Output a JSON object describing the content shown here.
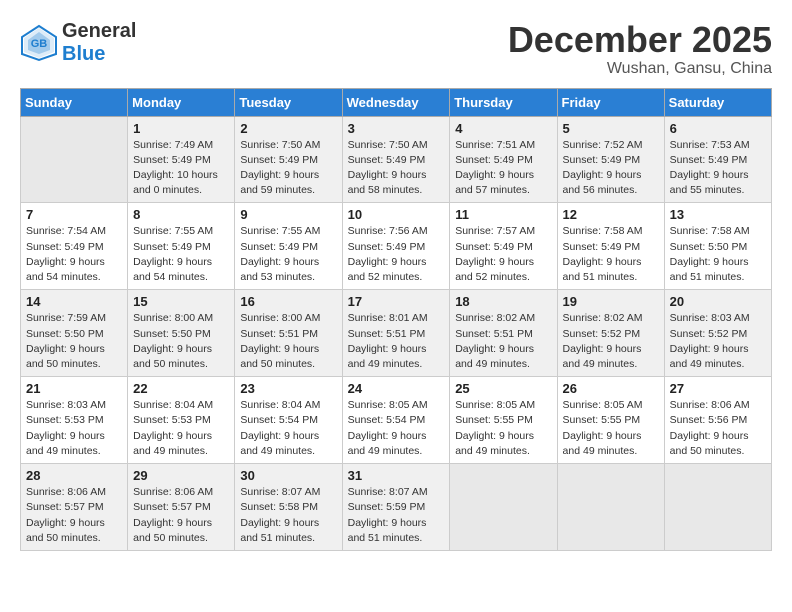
{
  "logo": {
    "general": "General",
    "blue": "Blue"
  },
  "title": "December 2025",
  "location": "Wushan, Gansu, China",
  "days_of_week": [
    "Sunday",
    "Monday",
    "Tuesday",
    "Wednesday",
    "Thursday",
    "Friday",
    "Saturday"
  ],
  "weeks": [
    [
      {
        "day": "",
        "info": ""
      },
      {
        "day": "1",
        "info": "Sunrise: 7:49 AM\nSunset: 5:49 PM\nDaylight: 10 hours\nand 0 minutes."
      },
      {
        "day": "2",
        "info": "Sunrise: 7:50 AM\nSunset: 5:49 PM\nDaylight: 9 hours\nand 59 minutes."
      },
      {
        "day": "3",
        "info": "Sunrise: 7:50 AM\nSunset: 5:49 PM\nDaylight: 9 hours\nand 58 minutes."
      },
      {
        "day": "4",
        "info": "Sunrise: 7:51 AM\nSunset: 5:49 PM\nDaylight: 9 hours\nand 57 minutes."
      },
      {
        "day": "5",
        "info": "Sunrise: 7:52 AM\nSunset: 5:49 PM\nDaylight: 9 hours\nand 56 minutes."
      },
      {
        "day": "6",
        "info": "Sunrise: 7:53 AM\nSunset: 5:49 PM\nDaylight: 9 hours\nand 55 minutes."
      }
    ],
    [
      {
        "day": "7",
        "info": "Sunrise: 7:54 AM\nSunset: 5:49 PM\nDaylight: 9 hours\nand 54 minutes."
      },
      {
        "day": "8",
        "info": "Sunrise: 7:55 AM\nSunset: 5:49 PM\nDaylight: 9 hours\nand 54 minutes."
      },
      {
        "day": "9",
        "info": "Sunrise: 7:55 AM\nSunset: 5:49 PM\nDaylight: 9 hours\nand 53 minutes."
      },
      {
        "day": "10",
        "info": "Sunrise: 7:56 AM\nSunset: 5:49 PM\nDaylight: 9 hours\nand 52 minutes."
      },
      {
        "day": "11",
        "info": "Sunrise: 7:57 AM\nSunset: 5:49 PM\nDaylight: 9 hours\nand 52 minutes."
      },
      {
        "day": "12",
        "info": "Sunrise: 7:58 AM\nSunset: 5:49 PM\nDaylight: 9 hours\nand 51 minutes."
      },
      {
        "day": "13",
        "info": "Sunrise: 7:58 AM\nSunset: 5:50 PM\nDaylight: 9 hours\nand 51 minutes."
      }
    ],
    [
      {
        "day": "14",
        "info": "Sunrise: 7:59 AM\nSunset: 5:50 PM\nDaylight: 9 hours\nand 50 minutes."
      },
      {
        "day": "15",
        "info": "Sunrise: 8:00 AM\nSunset: 5:50 PM\nDaylight: 9 hours\nand 50 minutes."
      },
      {
        "day": "16",
        "info": "Sunrise: 8:00 AM\nSunset: 5:51 PM\nDaylight: 9 hours\nand 50 minutes."
      },
      {
        "day": "17",
        "info": "Sunrise: 8:01 AM\nSunset: 5:51 PM\nDaylight: 9 hours\nand 49 minutes."
      },
      {
        "day": "18",
        "info": "Sunrise: 8:02 AM\nSunset: 5:51 PM\nDaylight: 9 hours\nand 49 minutes."
      },
      {
        "day": "19",
        "info": "Sunrise: 8:02 AM\nSunset: 5:52 PM\nDaylight: 9 hours\nand 49 minutes."
      },
      {
        "day": "20",
        "info": "Sunrise: 8:03 AM\nSunset: 5:52 PM\nDaylight: 9 hours\nand 49 minutes."
      }
    ],
    [
      {
        "day": "21",
        "info": "Sunrise: 8:03 AM\nSunset: 5:53 PM\nDaylight: 9 hours\nand 49 minutes."
      },
      {
        "day": "22",
        "info": "Sunrise: 8:04 AM\nSunset: 5:53 PM\nDaylight: 9 hours\nand 49 minutes."
      },
      {
        "day": "23",
        "info": "Sunrise: 8:04 AM\nSunset: 5:54 PM\nDaylight: 9 hours\nand 49 minutes."
      },
      {
        "day": "24",
        "info": "Sunrise: 8:05 AM\nSunset: 5:54 PM\nDaylight: 9 hours\nand 49 minutes."
      },
      {
        "day": "25",
        "info": "Sunrise: 8:05 AM\nSunset: 5:55 PM\nDaylight: 9 hours\nand 49 minutes."
      },
      {
        "day": "26",
        "info": "Sunrise: 8:05 AM\nSunset: 5:55 PM\nDaylight: 9 hours\nand 49 minutes."
      },
      {
        "day": "27",
        "info": "Sunrise: 8:06 AM\nSunset: 5:56 PM\nDaylight: 9 hours\nand 50 minutes."
      }
    ],
    [
      {
        "day": "28",
        "info": "Sunrise: 8:06 AM\nSunset: 5:57 PM\nDaylight: 9 hours\nand 50 minutes."
      },
      {
        "day": "29",
        "info": "Sunrise: 8:06 AM\nSunset: 5:57 PM\nDaylight: 9 hours\nand 50 minutes."
      },
      {
        "day": "30",
        "info": "Sunrise: 8:07 AM\nSunset: 5:58 PM\nDaylight: 9 hours\nand 51 minutes."
      },
      {
        "day": "31",
        "info": "Sunrise: 8:07 AM\nSunset: 5:59 PM\nDaylight: 9 hours\nand 51 minutes."
      },
      {
        "day": "",
        "info": ""
      },
      {
        "day": "",
        "info": ""
      },
      {
        "day": "",
        "info": ""
      }
    ]
  ]
}
